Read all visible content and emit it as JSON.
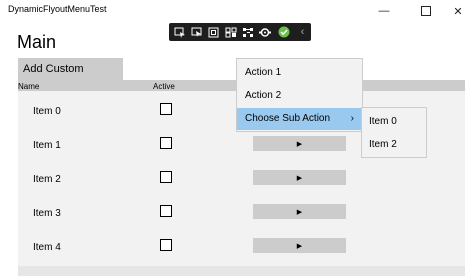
{
  "window": {
    "title": "DynamicFlyoutMenuTest",
    "minimize_glyph": "—",
    "close_glyph": "✕"
  },
  "toolbar": {
    "icons": [
      "select-element-icon",
      "display-layout-icon",
      "track-focus-icon",
      "xaml-binding-icon",
      "hot-reload-icon",
      "settings-icon",
      "status-ok-icon",
      "collapse-chevron-icon"
    ],
    "collapse_glyph": "‹"
  },
  "page": {
    "title": "Main"
  },
  "tab": {
    "label": "Add Custom ListItem"
  },
  "list": {
    "headers": {
      "name": "Name",
      "active": "Active"
    },
    "play_glyph": "▶",
    "rows": [
      {
        "label": "Item 0",
        "active": false
      },
      {
        "label": "Item 1",
        "active": false
      },
      {
        "label": "Item 2",
        "active": false
      },
      {
        "label": "Item 3",
        "active": false
      },
      {
        "label": "Item 4",
        "active": false
      }
    ]
  },
  "flyout": {
    "items": [
      {
        "label": "Action 1"
      },
      {
        "label": "Action 2"
      },
      {
        "label": "Choose Sub Action"
      }
    ],
    "submenu_chevron": "›",
    "highlight_color": "#99c9ef"
  },
  "submenu": {
    "items": [
      {
        "label": "Item 0"
      },
      {
        "label": "Item 2"
      }
    ]
  }
}
